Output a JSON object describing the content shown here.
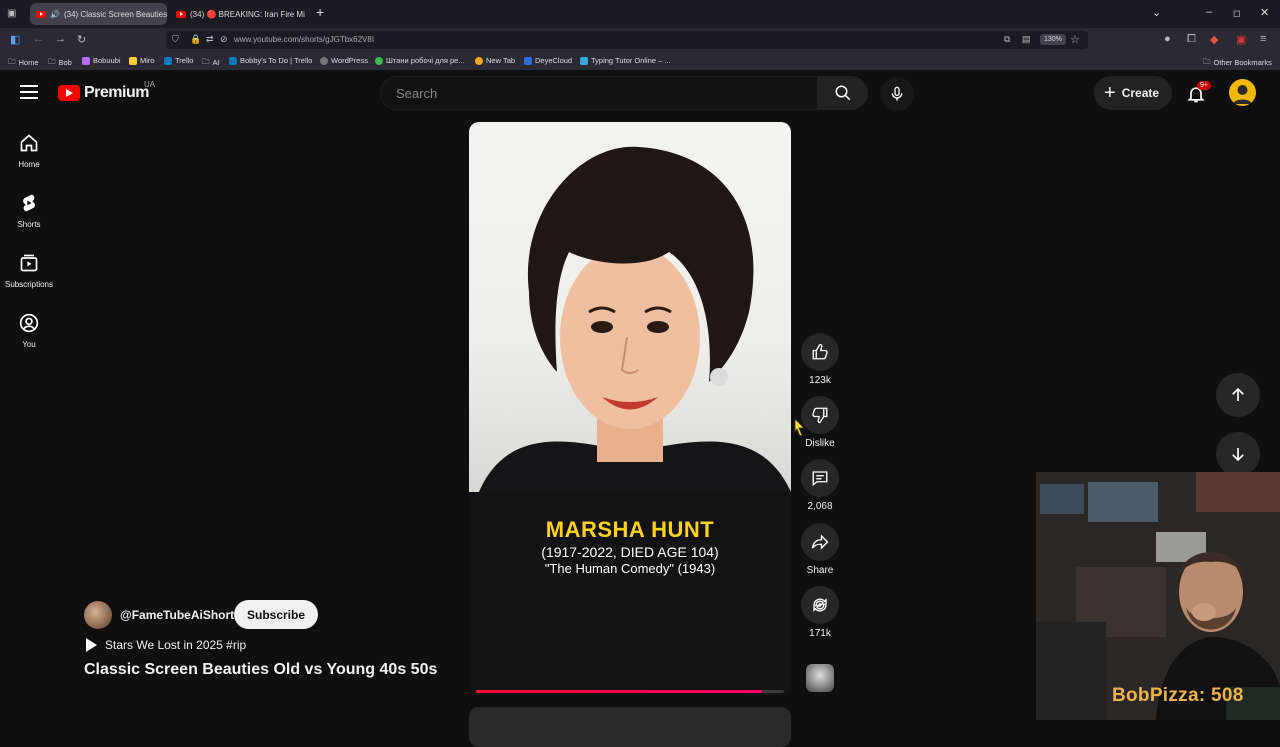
{
  "browser": {
    "tabs": [
      {
        "label": "(34) Classic Screen Beauties",
        "active": true
      },
      {
        "label": "(34) 🔴 BREAKING: Iran Fire Mi",
        "active": false
      }
    ],
    "url": "www.youtube.com/shorts/gJGTbx62V8I",
    "zoom": "130%",
    "bookmarks": [
      "Home",
      "Bob",
      "Bobuubi",
      "Miro",
      "Trello",
      "AI",
      "Bobby's To Do | Trello",
      "WordPress",
      "Штани робочі для ре...",
      "New Tab",
      "DeyeCloud",
      "Typing Tutor Online – ..."
    ],
    "other_bookmarks": "Other Bookmarks"
  },
  "header": {
    "logo": "Premium",
    "country": "UA",
    "search_placeholder": "Search",
    "create_label": "Create",
    "notifications": "9+"
  },
  "sidebar": {
    "items": [
      {
        "label": "Home",
        "icon": "home-icon"
      },
      {
        "label": "Shorts",
        "icon": "shorts-icon"
      },
      {
        "label": "Subscriptions",
        "icon": "subscriptions-icon"
      },
      {
        "label": "You",
        "icon": "you-icon"
      }
    ]
  },
  "short": {
    "caption_name": "MARSHA HUNT",
    "caption_years": "(1917-2022, DIED AGE 104)",
    "caption_film": "\"The Human Comedy\" (1943)",
    "progress": 0.93,
    "channel": "@FameTubeAiShorts",
    "subscribe_label": "Subscribe",
    "playlist": "Stars We Lost in 2025 #rip",
    "title": "Classic Screen Beauties Old vs Young 40s 50s"
  },
  "actions": {
    "likes": "123k",
    "dislike": "Dislike",
    "comments": "2,068",
    "share": "Share",
    "remix": "171k"
  },
  "overlay": {
    "streamer_tag": "BobPizza: 508"
  },
  "colors": {
    "youtube_red": "#ff0000",
    "caption_yellow": "#ffd21f",
    "streamer_tag": "#f0b24a"
  }
}
